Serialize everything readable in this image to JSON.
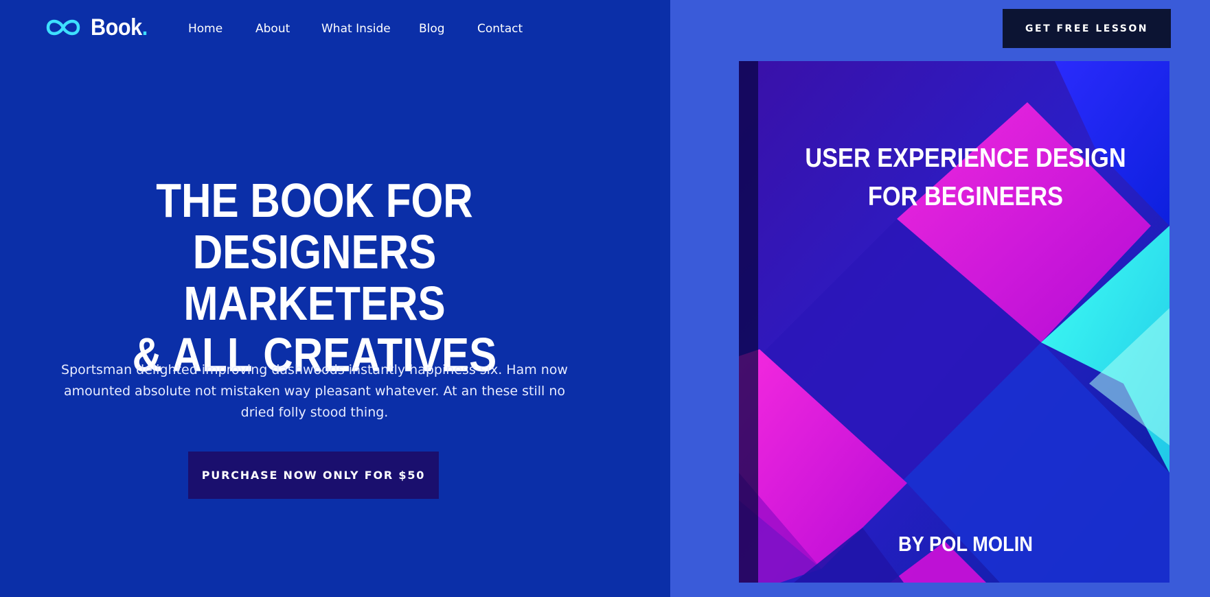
{
  "brand": {
    "name": "Book",
    "dot": ".",
    "icon": "infinity-logo-icon"
  },
  "nav": {
    "items": [
      {
        "label": "Home"
      },
      {
        "label": "About"
      },
      {
        "label": "What Inside"
      },
      {
        "label": "Blog"
      },
      {
        "label": "Contact"
      }
    ]
  },
  "header": {
    "cta_label": "GET FREE LESSON"
  },
  "hero": {
    "title_line1": "THE BOOK FOR",
    "title_line2": "DESIGNERS MARKETERS",
    "title_line3": "& ALL CREATIVES",
    "description": "Sportsman delighted improving dashwoods instantly happiness six. Ham now amounted absolute not mistaken way pleasant whatever. At an these still no dried folly stood thing.",
    "cta_label": "PURCHASE NOW ONLY FOR $50"
  },
  "book": {
    "title_line1": "USER EXPERIENCE DESIGN",
    "title_line2": "FOR BEGINEERS",
    "author": "BY POL MOLIN"
  },
  "colors": {
    "left_bg": "#0b2fa8",
    "right_bg": "#3a5bd9",
    "accent_cyan": "#3ee0ff",
    "dark_button": "#0c1433",
    "purchase_button": "#1a0f6e",
    "magenta": "#ff10d8",
    "cyan_block": "#38f6f0"
  }
}
